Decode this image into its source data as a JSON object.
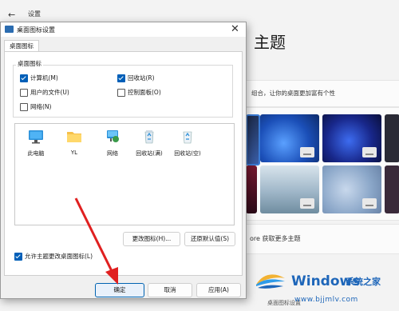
{
  "settings": {
    "back_glyph": "←",
    "title": "设置",
    "heading": "主题",
    "description": "组合，让你的桌面更加富有个性",
    "more_themes": "ore 获取更多主题",
    "bottom_text": "桌面图标设置"
  },
  "dialog": {
    "title": "桌面图标设置",
    "close_glyph": "✕",
    "tab": "桌面图标",
    "group_label": "桌面图标",
    "checkboxes": [
      {
        "label": "计算机(M)",
        "checked": true
      },
      {
        "label": "回收站(R)",
        "checked": true
      },
      {
        "label": "用户的文件(U)",
        "checked": false
      },
      {
        "label": "控制面板(O)",
        "checked": false
      },
      {
        "label": "网络(N)",
        "checked": false
      }
    ],
    "icons": [
      {
        "label": "此电脑",
        "icon": "monitor-icon"
      },
      {
        "label": "YL",
        "icon": "folder-icon"
      },
      {
        "label": "网络",
        "icon": "network-icon"
      },
      {
        "label": "回收站(满)",
        "icon": "recycle-bin-full-icon"
      },
      {
        "label": "回收站(空)",
        "icon": "recycle-bin-empty-icon"
      }
    ],
    "change_icon": "更改图标(H)...",
    "restore_default": "还原默认值(S)",
    "allow_themes": "允许主题更改桌面图标(L)",
    "allow_themes_checked": true,
    "ok": "确定",
    "cancel": "取消",
    "apply": "应用(A)"
  },
  "watermark": {
    "brand": "Windows",
    "site_name": "系统之家",
    "url": "www.bjjmlv.com"
  },
  "colors": {
    "accent": "#005fb8",
    "arrow": "#e02020",
    "watermark": "#1e66b9"
  }
}
